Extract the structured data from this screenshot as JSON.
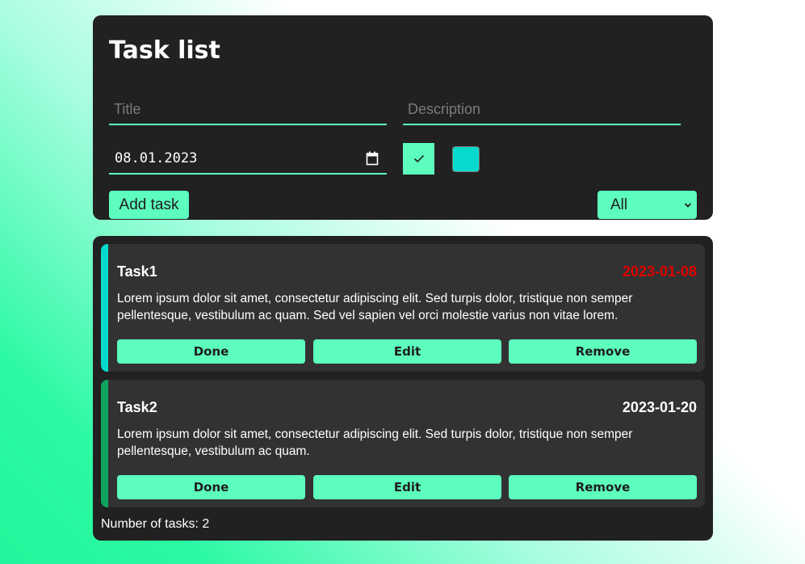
{
  "header": {
    "title": "Task list"
  },
  "form": {
    "title_placeholder": "Title",
    "description_placeholder": "Description",
    "date_value": "08.01.2023",
    "completed_checked": true,
    "color_value": "#06dacc",
    "add_button_label": "Add task",
    "filter_selected": "All"
  },
  "tasks": [
    {
      "title": "Task1",
      "date": "2023-01-08",
      "date_color": "#e00000",
      "accent_color": "#06dacc",
      "description": "Lorem ipsum dolor sit amet, consectetur adipiscing elit. Sed turpis dolor, tristique non semper pellentesque, vestibulum ac quam. Sed vel sapien vel orci molestie varius non vitae lorem.",
      "done_label": "Done",
      "edit_label": "Edit",
      "remove_label": "Remove"
    },
    {
      "title": "Task2",
      "date": "2023-01-20",
      "date_color": "#ffffff",
      "accent_color": "#0ea35f",
      "description": "Lorem ipsum dolor sit amet, consectetur adipiscing elit. Sed turpis dolor, tristique non semper pellentesque, vestibulum ac quam.",
      "done_label": "Done",
      "edit_label": "Edit",
      "remove_label": "Remove"
    }
  ],
  "footer": {
    "count_label": "Number of tasks:",
    "count_value": "2"
  },
  "icons": {
    "date": "calendar-icon",
    "completed": "check-icon",
    "filter": "chevron-down-icon"
  },
  "colors": {
    "accent": "#5dfdbe",
    "panel": "#212121",
    "card": "#323232"
  }
}
